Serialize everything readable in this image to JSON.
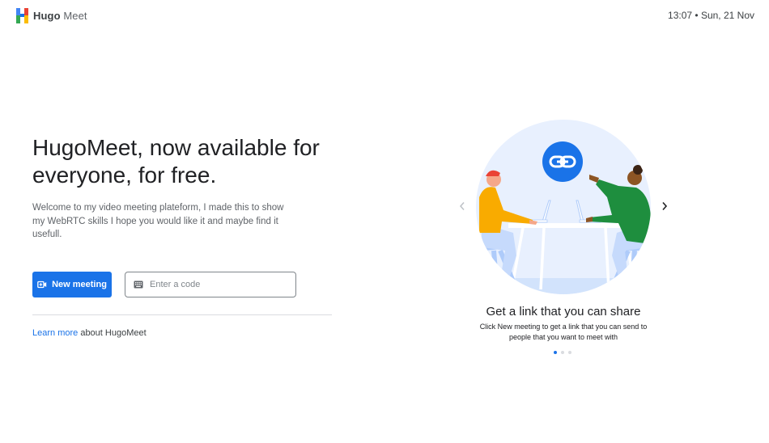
{
  "header": {
    "brand_bold": "Hugo",
    "brand_light": "Meet",
    "clock": "13:07 • Sun, 21 Nov"
  },
  "hero": {
    "headline_line1": "HugoMeet, now available for",
    "headline_line2": "everyone, for free.",
    "description": "Welcome to my video meeting plateform, I made this to show my WebRTC skills I hope you would like it and maybe find it usefull."
  },
  "actions": {
    "new_meeting_label": "New meeting",
    "code_placeholder": "Enter a code",
    "code_value": ""
  },
  "learn_more": {
    "link_text": "Learn more",
    "suffix": " about HugoMeet"
  },
  "carousel": {
    "title": "Get a link that you can share",
    "description": "Click New meeting to get a link that you can send to people that you want to meet with",
    "slide_count": 3,
    "active_index": 0
  },
  "colors": {
    "accent": "#1a73e8",
    "illustration_bg": "#e8f0fe",
    "person_left_shirt": "#f9ab00",
    "person_right_shirt": "#1e8e3e"
  },
  "icons": {
    "logo": "hugo-meet-logo",
    "new_meeting": "video-plus-icon",
    "code_field": "keyboard-icon",
    "prev": "chevron-left-icon",
    "next": "chevron-right-icon",
    "link": "link-icon"
  }
}
